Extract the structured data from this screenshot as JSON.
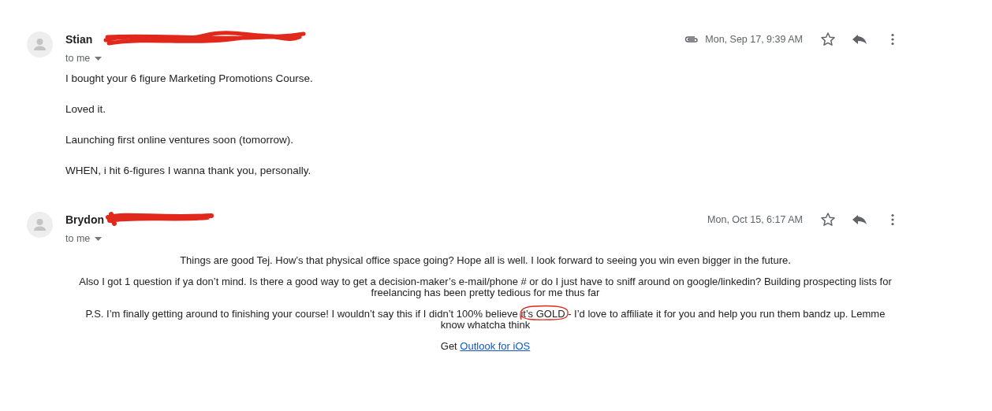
{
  "messages": [
    {
      "sender": "Stian",
      "redacted": true,
      "recipient": "to me",
      "attachment": true,
      "date": "Mon, Sep 17, 9:39 AM",
      "starred": false,
      "paragraphs": [
        {
          "kind": "plain",
          "text": "I bought your 6 figure Marketing Promotions Course."
        },
        {
          "kind": "plain",
          "text": "Loved it."
        },
        {
          "kind": "plain",
          "text": "Launching first online ventures soon (tomorrow)."
        },
        {
          "kind": "plain",
          "text": "WHEN, i hit 6-figures I wanna thank you, personally."
        }
      ]
    },
    {
      "sender": "Brydon",
      "redacted": true,
      "recipient": "to me",
      "attachment": false,
      "date": "Mon, Oct 15, 6:17 AM",
      "starred": false,
      "paragraphs": [
        {
          "kind": "centered",
          "text": "Things are good Tej.  How’s that physical office space going? Hope all is well. I look forward to seeing you win even bigger in the future."
        },
        {
          "kind": "centered",
          "text": "Also I got 1 question if ya don’t mind.  Is there a good way to get a decision-maker’s e-mail/phone # or do I just have to sniff around on google/linkedin?  Building prospecting lists for freelancing has been pretty tedious for me thus far"
        },
        {
          "kind": "circled",
          "before": "P.S. I’m finally getting around to finishing your course! I wouldn’t say this if I didn’t 100% believe ",
          "circled": "it’s GOLD",
          "after": " - I’d love to affiliate it for you and help you run them bandz up. Lemme know whatcha think"
        },
        {
          "kind": "link",
          "before": "Get ",
          "link": "Outlook for iOS"
        }
      ]
    }
  ]
}
